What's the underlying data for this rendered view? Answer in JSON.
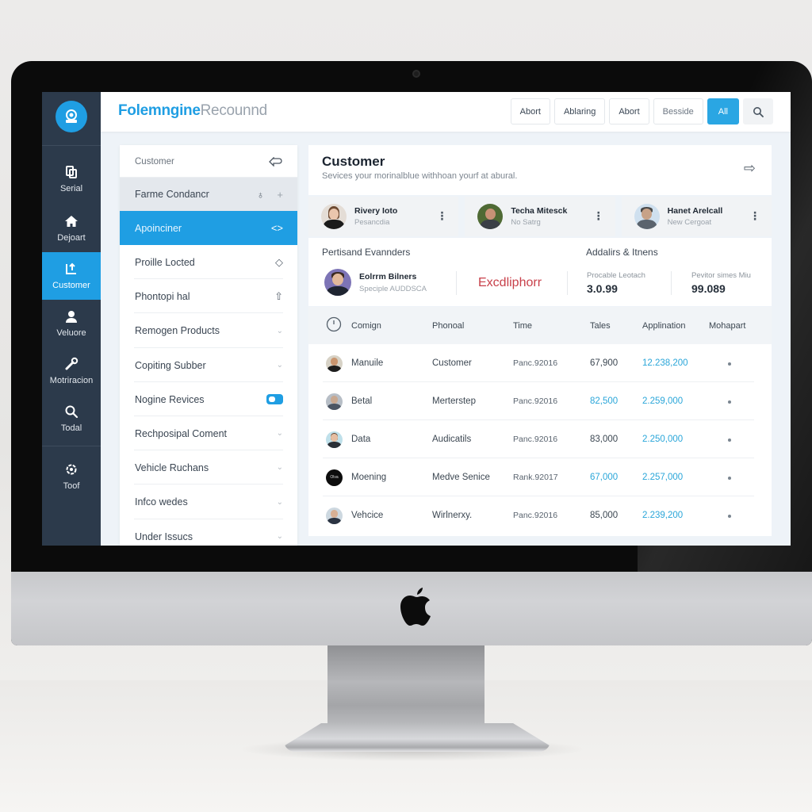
{
  "device": {
    "type": "desktop monitor",
    "logo_icon": "apple-logo-icon"
  },
  "app": {
    "brand_primary": "Folemngine",
    "brand_secondary": "Recounnd",
    "accent_color": "#1f9ee3",
    "logo_icon": "webcam-icon"
  },
  "header": {
    "buttons": [
      {
        "label": "Abort",
        "style": "default"
      },
      {
        "label": "Ablaring",
        "style": "default"
      },
      {
        "label": "Abort",
        "style": "default"
      },
      {
        "label": "Besside",
        "style": "muted"
      },
      {
        "label": "All",
        "style": "primary"
      }
    ],
    "search_icon": "search-icon"
  },
  "sidebar": {
    "items": [
      {
        "label": "Serial",
        "icon": "document-copy-icon",
        "active": false
      },
      {
        "label": "Dejoart",
        "icon": "home-icon",
        "active": false
      },
      {
        "label": "Customer",
        "icon": "chart-upload-icon",
        "active": true
      },
      {
        "label": "Veluore",
        "icon": "user-icon",
        "active": false
      },
      {
        "label": "Motriracion",
        "icon": "wrench-icon",
        "active": false
      },
      {
        "label": "Todal",
        "icon": "search-icon",
        "active": false
      },
      {
        "label": "Toof",
        "icon": "settings-cog-icon",
        "active": false
      }
    ]
  },
  "menu": {
    "header": {
      "label": "Customer",
      "icon": "back-arrow-icon"
    },
    "items": [
      {
        "label": "Farme Condancr",
        "state": "hover",
        "icons": [
          "thumbs-up-icon",
          "plus-icon"
        ]
      },
      {
        "label": "Apoinciner",
        "state": "active",
        "icons": [
          "code-icon"
        ]
      },
      {
        "label": "Proille Locted",
        "state": "normal",
        "icons": [
          "diamond-icon"
        ]
      },
      {
        "label": "Phontopi hal",
        "state": "normal",
        "icons": [
          "pointer-icon"
        ]
      },
      {
        "label": "Remogen Products",
        "state": "normal",
        "icons": [
          "chevron-down-icon"
        ]
      },
      {
        "label": "Copiting Subber",
        "state": "normal",
        "icons": [
          "chevron-down-icon"
        ]
      },
      {
        "label": "Nogine Revices",
        "state": "normal",
        "icons": [
          "toggle-icon"
        ],
        "toggle_on": true
      },
      {
        "label": "Rechposipal Coment",
        "state": "normal",
        "icons": [
          "chevron-down-icon"
        ]
      },
      {
        "label": "Vehicle Ruchans",
        "state": "normal",
        "icons": [
          "chevron-down-icon"
        ]
      },
      {
        "label": "Infco wedes",
        "state": "normal",
        "icons": [
          "chevron-down-icon"
        ]
      },
      {
        "label": "Under Issucs",
        "state": "normal",
        "icons": [
          "chevron-down-icon"
        ]
      }
    ]
  },
  "main": {
    "title": "Customer",
    "subtitle": "Sevices your morinalblue withhoan yourf at abural.",
    "people": [
      {
        "name": "Rivery Ioto",
        "role": "Pesancdia"
      },
      {
        "name": "Techa Mitesck",
        "role": "No Satrg"
      },
      {
        "name": "Hanet Arelcall",
        "role": "New Cergoat"
      }
    ],
    "summary": {
      "left_label": "Pertisand Evannders",
      "right_label": "Addalirs & Itnens",
      "person": {
        "name": "Eolrrm Bilners",
        "role": "Speciple AUDDSCA"
      },
      "brand_word": "Excdliphorr",
      "stats": [
        {
          "label": "Procable Leotach",
          "value": "3.0.99"
        },
        {
          "label": "Pevitor simes Miu",
          "value": "99.089"
        }
      ]
    },
    "table": {
      "header_icon": "clock-icon",
      "columns": [
        "Comign",
        "Phonoal",
        "Time",
        "Tales",
        "Applination",
        "Mohapart"
      ],
      "rows": [
        {
          "name": "Manuile",
          "type": "Customer",
          "time": "Panc.92016",
          "tales": "67,900",
          "tales_highlight": false,
          "app": "12.238,200",
          "status": "dot"
        },
        {
          "name": "Betal",
          "type": "Merterstep",
          "time": "Panc.92016",
          "tales": "82,500",
          "tales_highlight": true,
          "app": "2.259,000",
          "status": "dot"
        },
        {
          "name": "Data",
          "type": "Audicatils",
          "time": "Panc.92016",
          "tales": "83,000",
          "tales_highlight": false,
          "app": "2.250,000",
          "status": "dot"
        },
        {
          "name": "Moening",
          "type": "Medve Senice",
          "time": "Rank.92017",
          "tales": "67,000",
          "tales_highlight": true,
          "app": "2.257,000",
          "status": "dot"
        },
        {
          "name": "Vehcice",
          "type": "Wirlnerxy.",
          "time": "Panc.92016",
          "tales": "85,000",
          "tales_highlight": false,
          "app": "2.239,200",
          "status": "dot"
        }
      ]
    }
  }
}
